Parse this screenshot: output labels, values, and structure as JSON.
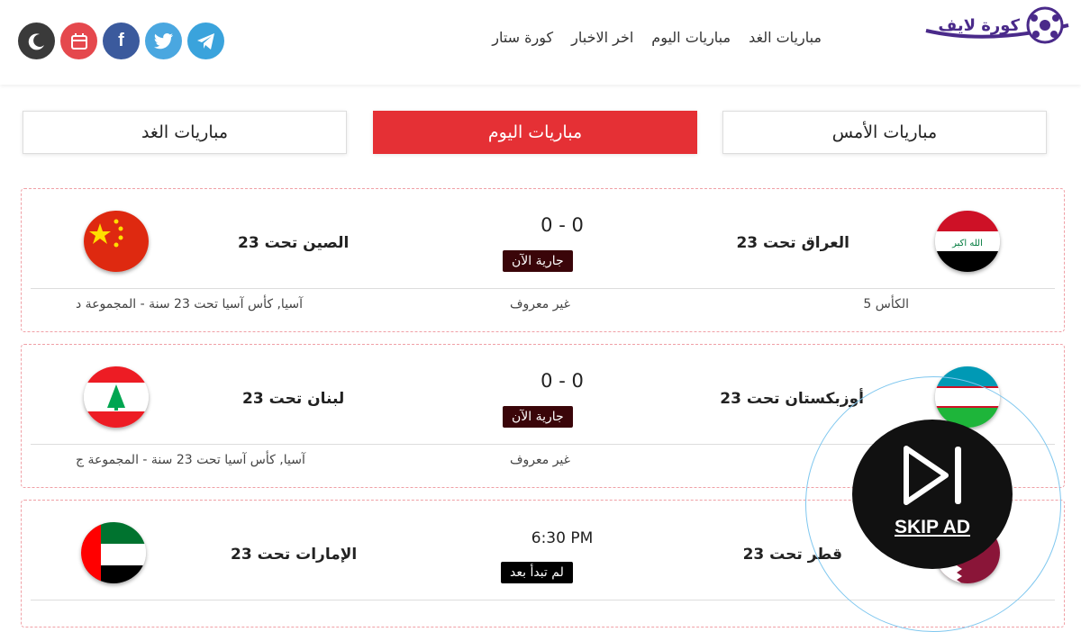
{
  "header": {
    "logo_text": "كورة لايف",
    "nav": [
      "كورة ستار",
      "اخر الاخبار",
      "مباريات اليوم",
      "مباريات الغد"
    ],
    "social_icons": [
      "moon-icon",
      "calendar-icon",
      "facebook-icon",
      "twitter-icon",
      "telegram-icon"
    ]
  },
  "tabs": {
    "yesterday": "مباريات الأمس",
    "today": "مباريات اليوم",
    "tomorrow": "مباريات الغد"
  },
  "matches": [
    {
      "home": "العراق تحت 23",
      "away": "الصين تحت 23",
      "score": "0 - 0",
      "status": "جارية الآن",
      "channel": "الكأس 5",
      "commentator": "غير معروف",
      "league": "آسيا, كأس آسيا تحت 23 سنة - المجموعة د"
    },
    {
      "home": "أوزبكستان تحت 23",
      "away": "لبنان تحت 23",
      "score": "0 - 0",
      "status": "جارية الآن",
      "channel": "",
      "commentator": "غير معروف",
      "league": "آسيا, كأس آسيا تحت 23 سنة - المجموعة ج"
    },
    {
      "home": "قطر تحت 23",
      "away": "الإمارات تحت 23",
      "time": "6:30 PM",
      "status": "لم تبدأ بعد"
    }
  ],
  "ad": {
    "skip_label": "SKIP AD"
  },
  "colors": {
    "accent": "#e53035",
    "status_bg": "#3a0509",
    "card_border": "#f0a0a6"
  }
}
